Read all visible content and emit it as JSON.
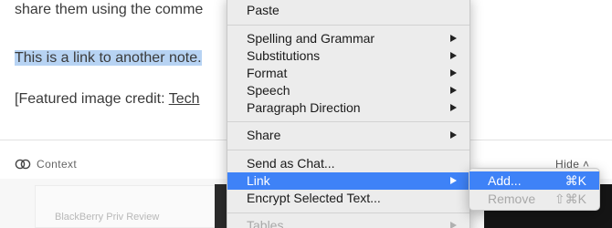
{
  "note": {
    "line1": "share them using the comme",
    "line2": "This is a link to another note.",
    "line3_prefix": "[Featured image credit: ",
    "line3_link": "Tech"
  },
  "context_bar": {
    "label": "Context",
    "hide_label": "Hide ˄"
  },
  "panel": {
    "card_text": "BlackBerry Priv Review"
  },
  "context_menu": {
    "paste": "Paste",
    "spelling": "Spelling and Grammar",
    "substitutions": "Substitutions",
    "format": "Format",
    "speech": "Speech",
    "paragraph_direction": "Paragraph Direction",
    "share": "Share",
    "send_as_chat": "Send as Chat...",
    "link": "Link",
    "encrypt": "Encrypt Selected Text...",
    "tables": "Tables"
  },
  "link_submenu": {
    "add": "Add...",
    "add_shortcut": "⌘K",
    "remove": "Remove",
    "remove_shortcut": "⇧⌘K"
  },
  "colors": {
    "highlight": "#3e82f7",
    "selection": "#b7d3f3"
  }
}
